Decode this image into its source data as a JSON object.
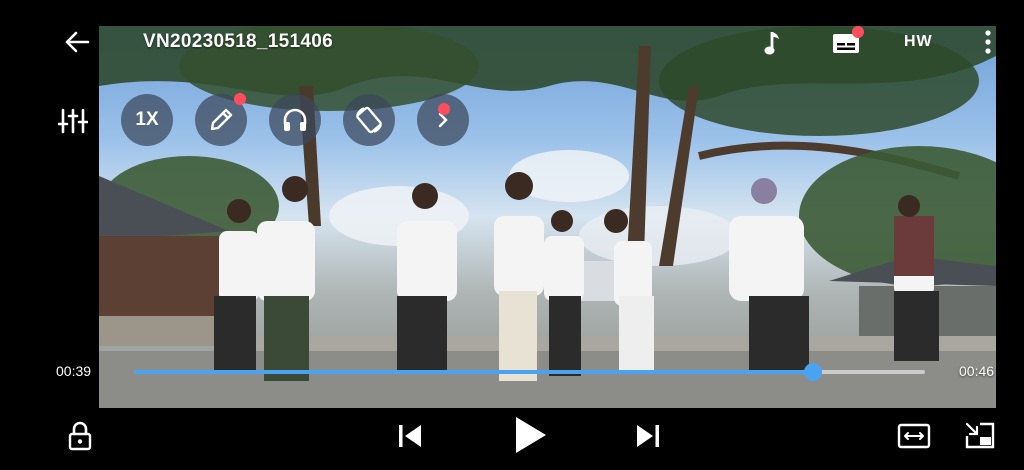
{
  "header": {
    "title": "VN20230518_151406",
    "quality_label": "HW",
    "icons": [
      "back-arrow-icon",
      "music-note-icon",
      "subtitle-icon",
      "more-vertical-icon"
    ]
  },
  "quick_controls": {
    "speed_label": "1X",
    "icons": [
      "equalizer-icon",
      "pencil-icon",
      "headphones-icon",
      "rotate-screen-icon",
      "chevron-right-icon"
    ]
  },
  "playback": {
    "current_time": "00:39",
    "total_time": "00:46",
    "progress": 0.858
  },
  "bottom_bar": {
    "icons": [
      "lock-icon",
      "previous-icon",
      "play-icon",
      "next-icon",
      "aspect-ratio-icon",
      "picture-in-picture-icon"
    ]
  },
  "colors": {
    "accent": "#4aa3f0",
    "badge": "#ff4d5e",
    "background": "#000000"
  }
}
